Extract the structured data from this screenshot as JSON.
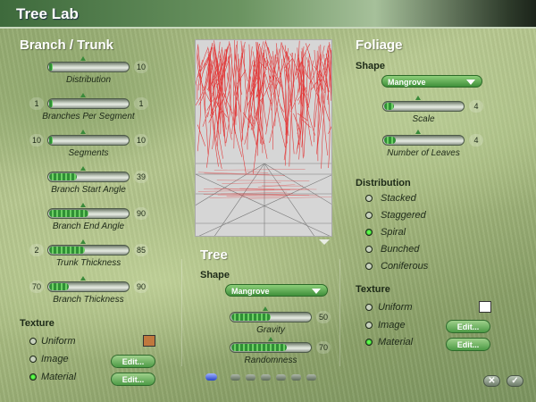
{
  "window": {
    "title": "Tree Lab"
  },
  "branch": {
    "heading": "Branch / Trunk",
    "sliders": [
      {
        "label": "Distribution",
        "min": "",
        "max": "10",
        "level": 0.05
      },
      {
        "label": "Branches Per Segment",
        "min": "1",
        "max": "1",
        "level": 0.0
      },
      {
        "label": "Segments",
        "min": "10",
        "max": "10",
        "level": 0.0
      },
      {
        "label": "Branch Start Angle",
        "min": "",
        "max": "39",
        "level": 0.35
      },
      {
        "label": "Branch End Angle",
        "min": "",
        "max": "90",
        "level": 0.5
      },
      {
        "label": "Trunk Thickness",
        "min": "2",
        "max": "85",
        "level": 0.45
      },
      {
        "label": "Branch Thickness",
        "min": "70",
        "max": "90",
        "level": 0.25
      }
    ],
    "texture": {
      "heading": "Texture",
      "options": [
        {
          "label": "Uniform",
          "selected": false
        },
        {
          "label": "Image",
          "selected": false
        },
        {
          "label": "Material",
          "selected": true
        }
      ],
      "swatch_color": "#c0783e",
      "edit_label": "Edit..."
    }
  },
  "tree": {
    "heading": "Tree",
    "shape_label": "Shape",
    "shape_value": "Mangrove",
    "sliders": [
      {
        "label": "Gravity",
        "max": "50",
        "level": 0.5
      },
      {
        "label": "Randomness",
        "max": "70",
        "level": 0.7
      }
    ]
  },
  "foliage": {
    "heading": "Foliage",
    "shape_label": "Shape",
    "shape_value": "Mangrove",
    "sliders": [
      {
        "label": "Scale",
        "max": "4",
        "level": 0.12
      },
      {
        "label": "Number of Leaves",
        "max": "4",
        "level": 0.15
      }
    ],
    "distribution": {
      "heading": "Distribution",
      "options": [
        {
          "label": "Stacked",
          "selected": false
        },
        {
          "label": "Staggered",
          "selected": false
        },
        {
          "label": "Spiral",
          "selected": true
        },
        {
          "label": "Bunched",
          "selected": false
        },
        {
          "label": "Coniferous",
          "selected": false
        }
      ]
    },
    "texture": {
      "heading": "Texture",
      "options": [
        {
          "label": "Uniform",
          "selected": false
        },
        {
          "label": "Image",
          "selected": false
        },
        {
          "label": "Material",
          "selected": true
        }
      ],
      "swatch_color": "#ffffff",
      "edit_label": "Edit..."
    }
  },
  "footer": {
    "cancel_icon": "close-icon",
    "ok_icon": "check-icon"
  },
  "colors": {
    "accent": "#4d9b46",
    "tree_lines": "#e23a3a"
  }
}
